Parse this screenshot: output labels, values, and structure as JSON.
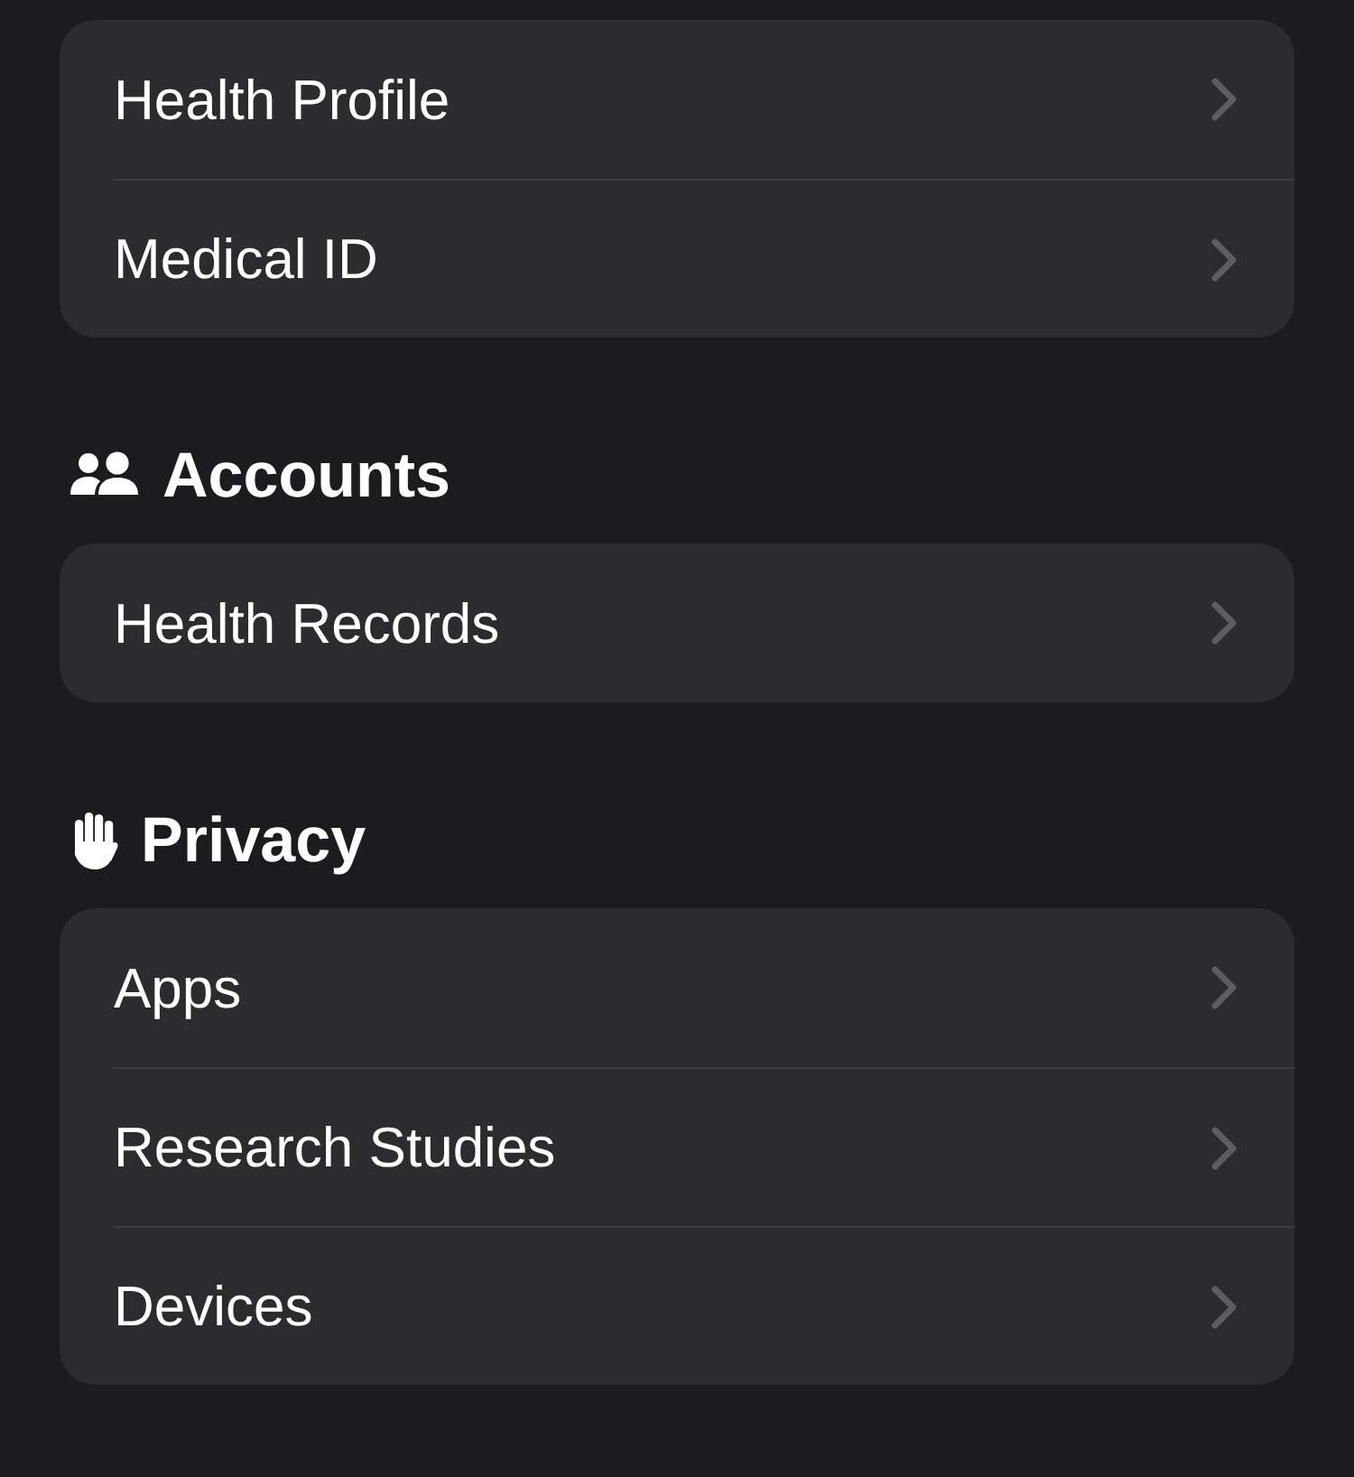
{
  "sections": [
    {
      "items": [
        {
          "label": "Health Profile"
        },
        {
          "label": "Medical ID"
        }
      ]
    },
    {
      "header": {
        "title": "Accounts"
      },
      "items": [
        {
          "label": "Health Records"
        }
      ]
    },
    {
      "header": {
        "title": "Privacy"
      },
      "items": [
        {
          "label": "Apps"
        },
        {
          "label": "Research Studies"
        },
        {
          "label": "Devices"
        }
      ]
    }
  ]
}
